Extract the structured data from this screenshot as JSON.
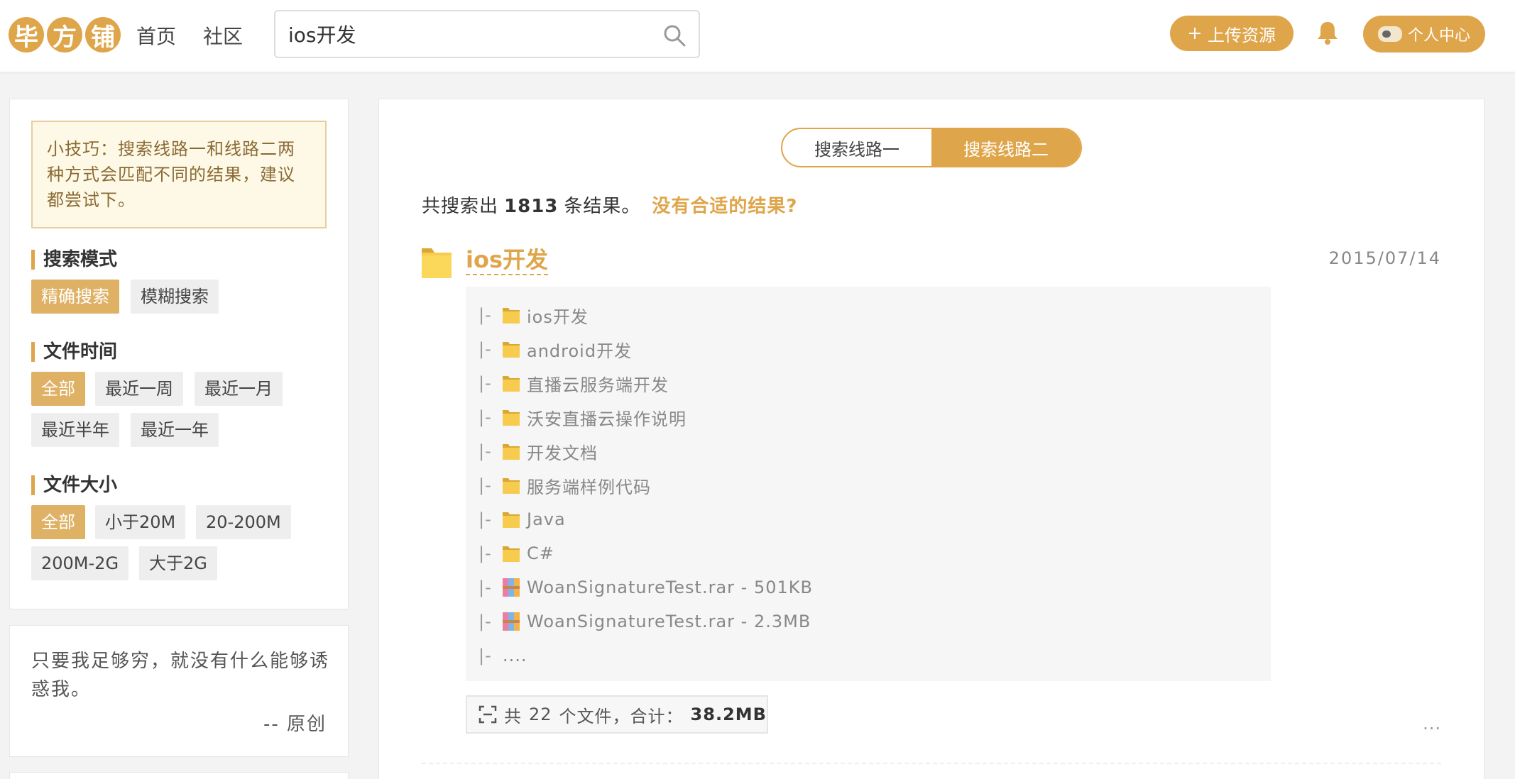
{
  "header": {
    "logo_chars": [
      "毕",
      "方",
      "铺"
    ],
    "nav": {
      "home": "首页",
      "community": "社区"
    },
    "search": {
      "value": "ios开发",
      "placeholder": ""
    },
    "upload_label": "上传资源",
    "user_label": "个人中心"
  },
  "sidebar": {
    "tip": "小技巧：搜索线路一和线路二两种方式会匹配不同的结果，建议都尝试下。",
    "search_mode": {
      "title": "搜索模式",
      "options": [
        "精确搜索",
        "模糊搜索"
      ],
      "selected": "精确搜索"
    },
    "file_time": {
      "title": "文件时间",
      "options": [
        "全部",
        "最近一周",
        "最近一月",
        "最近半年",
        "最近一年"
      ],
      "selected": "全部"
    },
    "file_size": {
      "title": "文件大小",
      "options": [
        "全部",
        "小于20M",
        "20-200M",
        "200M-2G",
        "大于2G"
      ],
      "selected": "全部"
    },
    "quote": {
      "text": "只要我足够穷，就没有什么能够诱惑我。",
      "author": "-- 原创"
    }
  },
  "main": {
    "routes": [
      "搜索线路一",
      "搜索线路二"
    ],
    "active_route": "搜索线路二",
    "summary": {
      "prefix": "共搜索出",
      "count": "1813",
      "suffix": "条结果。",
      "link": "没有合适的结果?"
    },
    "result": {
      "title": "ios开发",
      "date": "2015/07/14",
      "tree": [
        {
          "prefix": "|-",
          "type": "folder",
          "name": "ios开发"
        },
        {
          "prefix": "|-",
          "type": "folder",
          "name": "android开发"
        },
        {
          "prefix": "|-",
          "type": "folder",
          "name": "直播云服务端开发"
        },
        {
          "prefix": "|-",
          "type": "folder",
          "name": "沃安直播云操作说明"
        },
        {
          "prefix": "|-",
          "type": "folder",
          "name": "开发文档"
        },
        {
          "prefix": "|-",
          "type": "folder",
          "name": "服务端样例代码"
        },
        {
          "prefix": "|-",
          "type": "folder",
          "name": "Java"
        },
        {
          "prefix": "|-",
          "type": "folder",
          "name": "C#"
        },
        {
          "prefix": "|-",
          "type": "rar",
          "name": "WoanSignatureTest.rar - 501KB"
        },
        {
          "prefix": "|-",
          "type": "rar",
          "name": "WoanSignatureTest.rar - 2.3MB"
        },
        {
          "prefix": "|-",
          "type": "none",
          "name": "...."
        }
      ],
      "file_count": {
        "prefix": "共",
        "count": "22",
        "middle": "个文件，合计：",
        "total": "38.2MB"
      },
      "more": "..."
    }
  },
  "colors": {
    "accent": "#dfa54a",
    "folder": "#f7cb4d",
    "tip_bg": "#fef9e6"
  },
  "icons": {
    "search": "search-icon",
    "bell": "bell-icon",
    "plus": "plus-icon",
    "folder": "folder-icon",
    "rar": "rar-archive-icon",
    "scan": "scan-icon",
    "more": "more-icon"
  }
}
